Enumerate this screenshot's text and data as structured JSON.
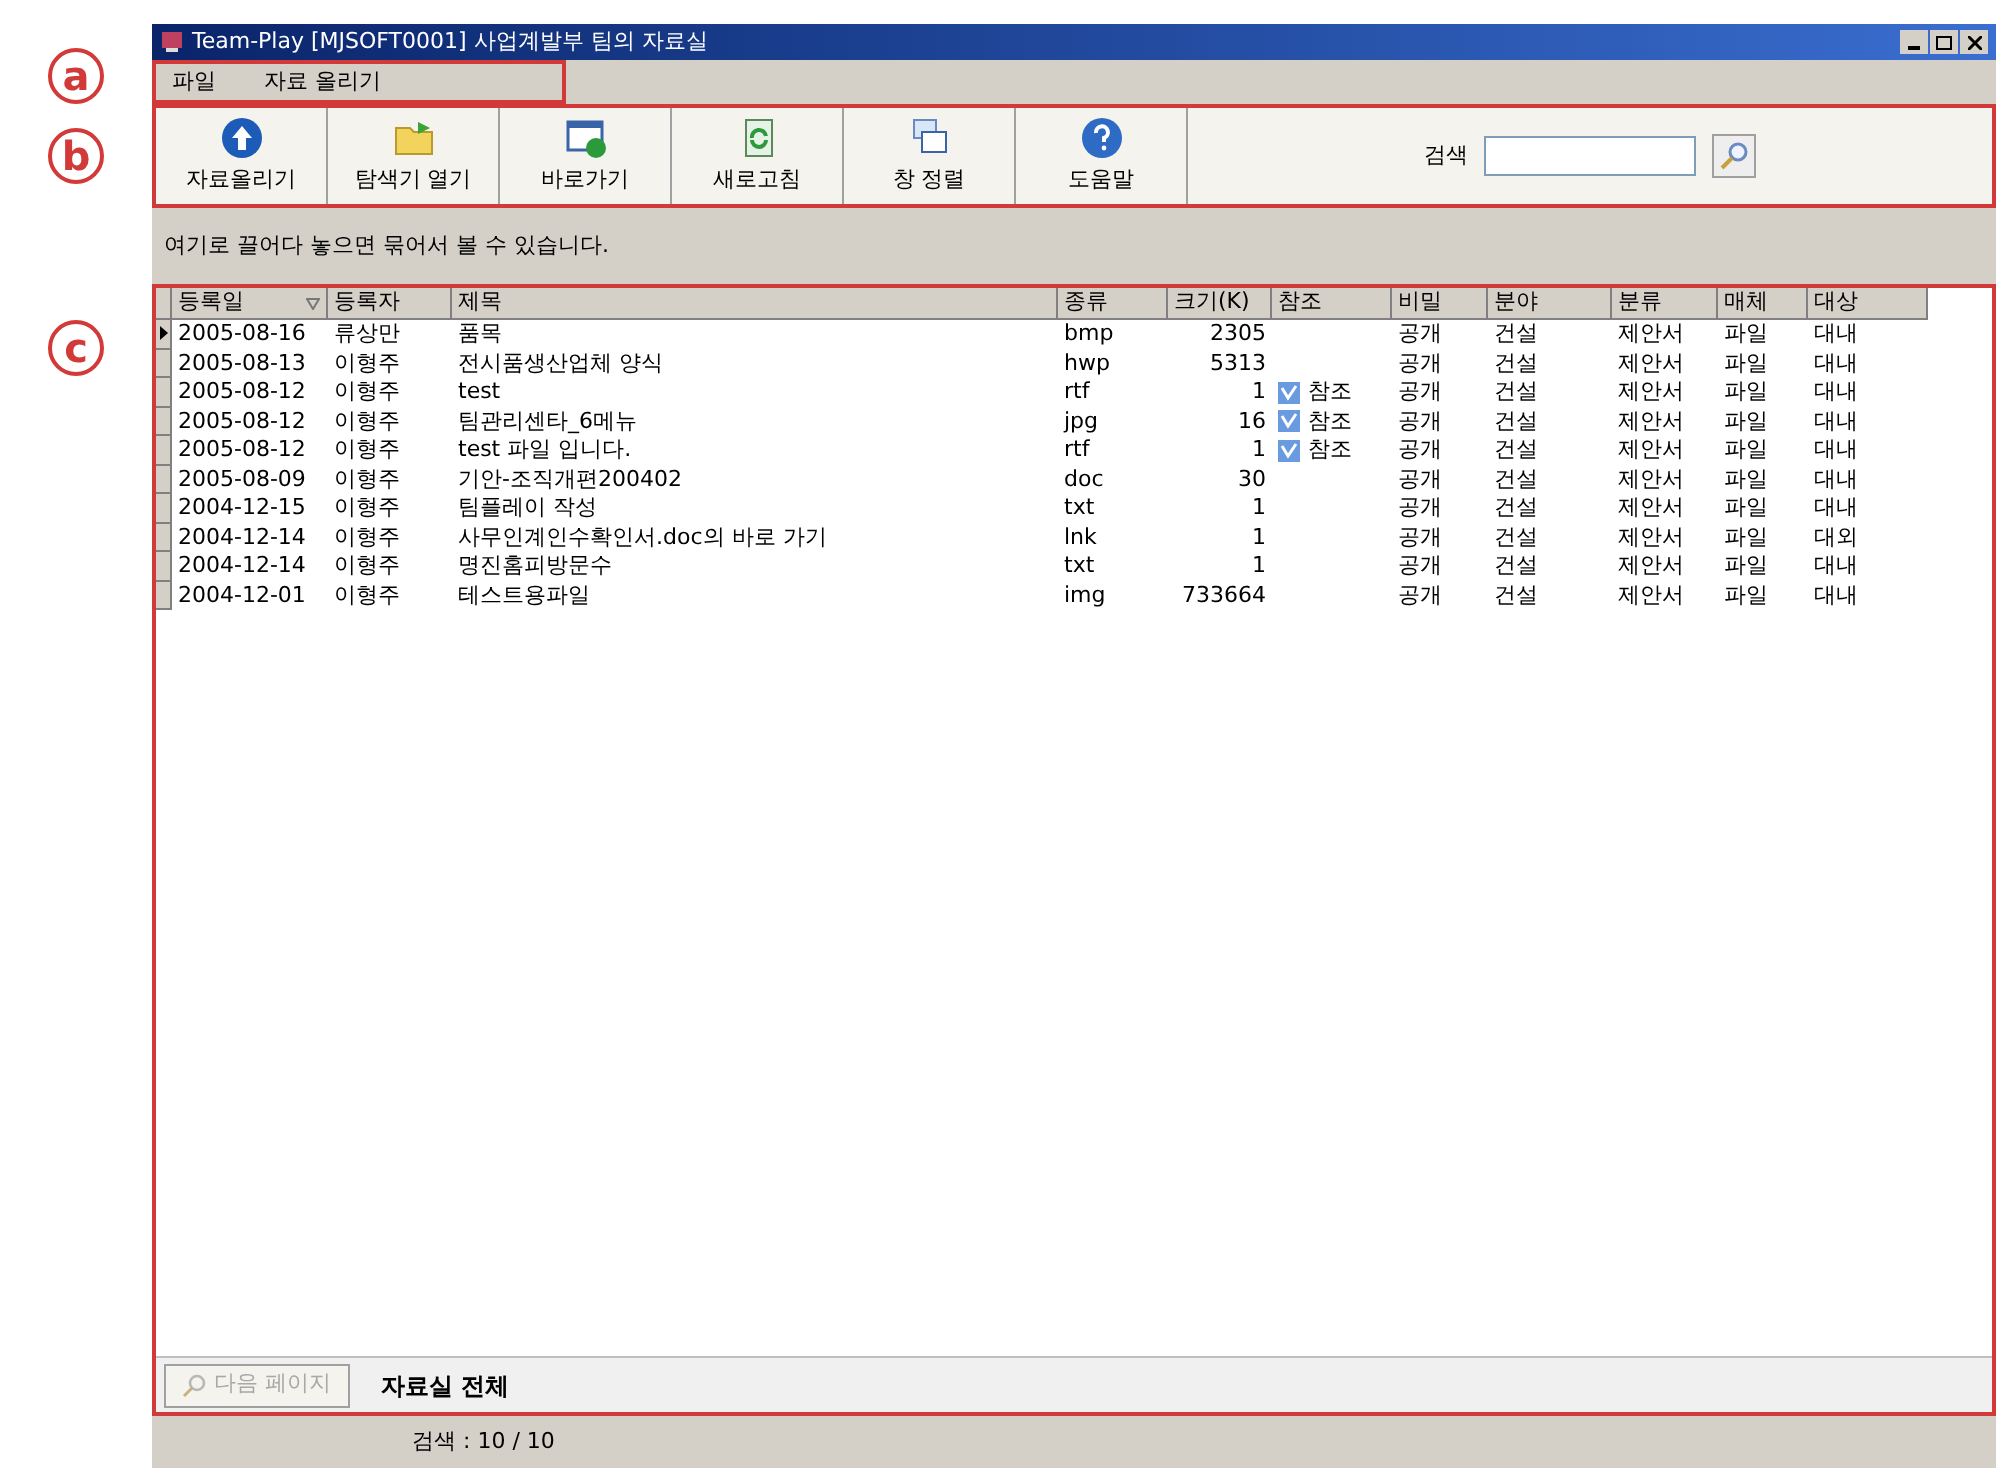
{
  "window": {
    "title": "Team-Play [MJSOFT0001] 사업계발부 팀의 자료실"
  },
  "callouts": [
    "a",
    "b",
    "c"
  ],
  "menu": [
    "파일",
    "자료 올리기"
  ],
  "toolbar": [
    {
      "label": "자료올리기",
      "kind": "upload"
    },
    {
      "label": "탐색기 열기",
      "kind": "explorer"
    },
    {
      "label": "바로가기",
      "kind": "shortcut"
    },
    {
      "label": "새로고침",
      "kind": "refresh"
    },
    {
      "label": "창 정렬",
      "kind": "windows"
    },
    {
      "label": "도움말",
      "kind": "help"
    }
  ],
  "search": {
    "label": "검색"
  },
  "drop_hint": "여기로 끌어다 놓으면 묶어서 볼 수 있습니다.",
  "table": {
    "columns": [
      "등록일",
      "등록자",
      "제목",
      "종류",
      "크기(K)",
      "참조",
      "비밀",
      "분야",
      "분류",
      "매체",
      "대상"
    ],
    "rows": [
      {
        "selected": true,
        "cells": [
          "2005-08-16",
          "류상만",
          "품목",
          "bmp",
          "2305",
          "",
          "공개",
          "건설",
          "제안서",
          "파일",
          "대내"
        ]
      },
      {
        "selected": false,
        "cells": [
          "2005-08-13",
          "이형주",
          "전시품생산업체 양식",
          "hwp",
          "5313",
          "",
          "공개",
          "건설",
          "제안서",
          "파일",
          "대내"
        ]
      },
      {
        "selected": false,
        "cells": [
          "2005-08-12",
          "이형주",
          "test",
          "rtf",
          "1",
          "참조",
          "공개",
          "건설",
          "제안서",
          "파일",
          "대내"
        ]
      },
      {
        "selected": false,
        "cells": [
          "2005-08-12",
          "이형주",
          "팀관리센타_6메뉴",
          "jpg",
          "16",
          "참조",
          "공개",
          "건설",
          "제안서",
          "파일",
          "대내"
        ]
      },
      {
        "selected": false,
        "cells": [
          "2005-08-12",
          "이형주",
          "test 파일 입니다.",
          "rtf",
          "1",
          "참조",
          "공개",
          "건설",
          "제안서",
          "파일",
          "대내"
        ]
      },
      {
        "selected": false,
        "cells": [
          "2005-08-09",
          "이형주",
          "기안-조직개편200402",
          "doc",
          "30",
          "",
          "공개",
          "건설",
          "제안서",
          "파일",
          "대내"
        ]
      },
      {
        "selected": false,
        "cells": [
          "2004-12-15",
          "이형주",
          "팀플레이 작성",
          "txt",
          "1",
          "",
          "공개",
          "건설",
          "제안서",
          "파일",
          "대내"
        ]
      },
      {
        "selected": false,
        "cells": [
          "2004-12-14",
          "이형주",
          "사무인계인수확인서.doc의 바로 가기",
          "lnk",
          "1",
          "",
          "공개",
          "건설",
          "제안서",
          "파일",
          "대외"
        ]
      },
      {
        "selected": false,
        "cells": [
          "2004-12-14",
          "이형주",
          "명진홈피방문수",
          "txt",
          "1",
          "",
          "공개",
          "건설",
          "제안서",
          "파일",
          "대내"
        ]
      },
      {
        "selected": false,
        "cells": [
          "2004-12-01",
          "이형주",
          "테스트용파일",
          "img",
          "733664",
          "",
          "공개",
          "건설",
          "제안서",
          "파일",
          "대내"
        ]
      }
    ]
  },
  "next_page": {
    "label": "다음 페이지",
    "disabled": true
  },
  "scope_label": "자료실 전체",
  "status_bar": "검색 : 10 / 10"
}
